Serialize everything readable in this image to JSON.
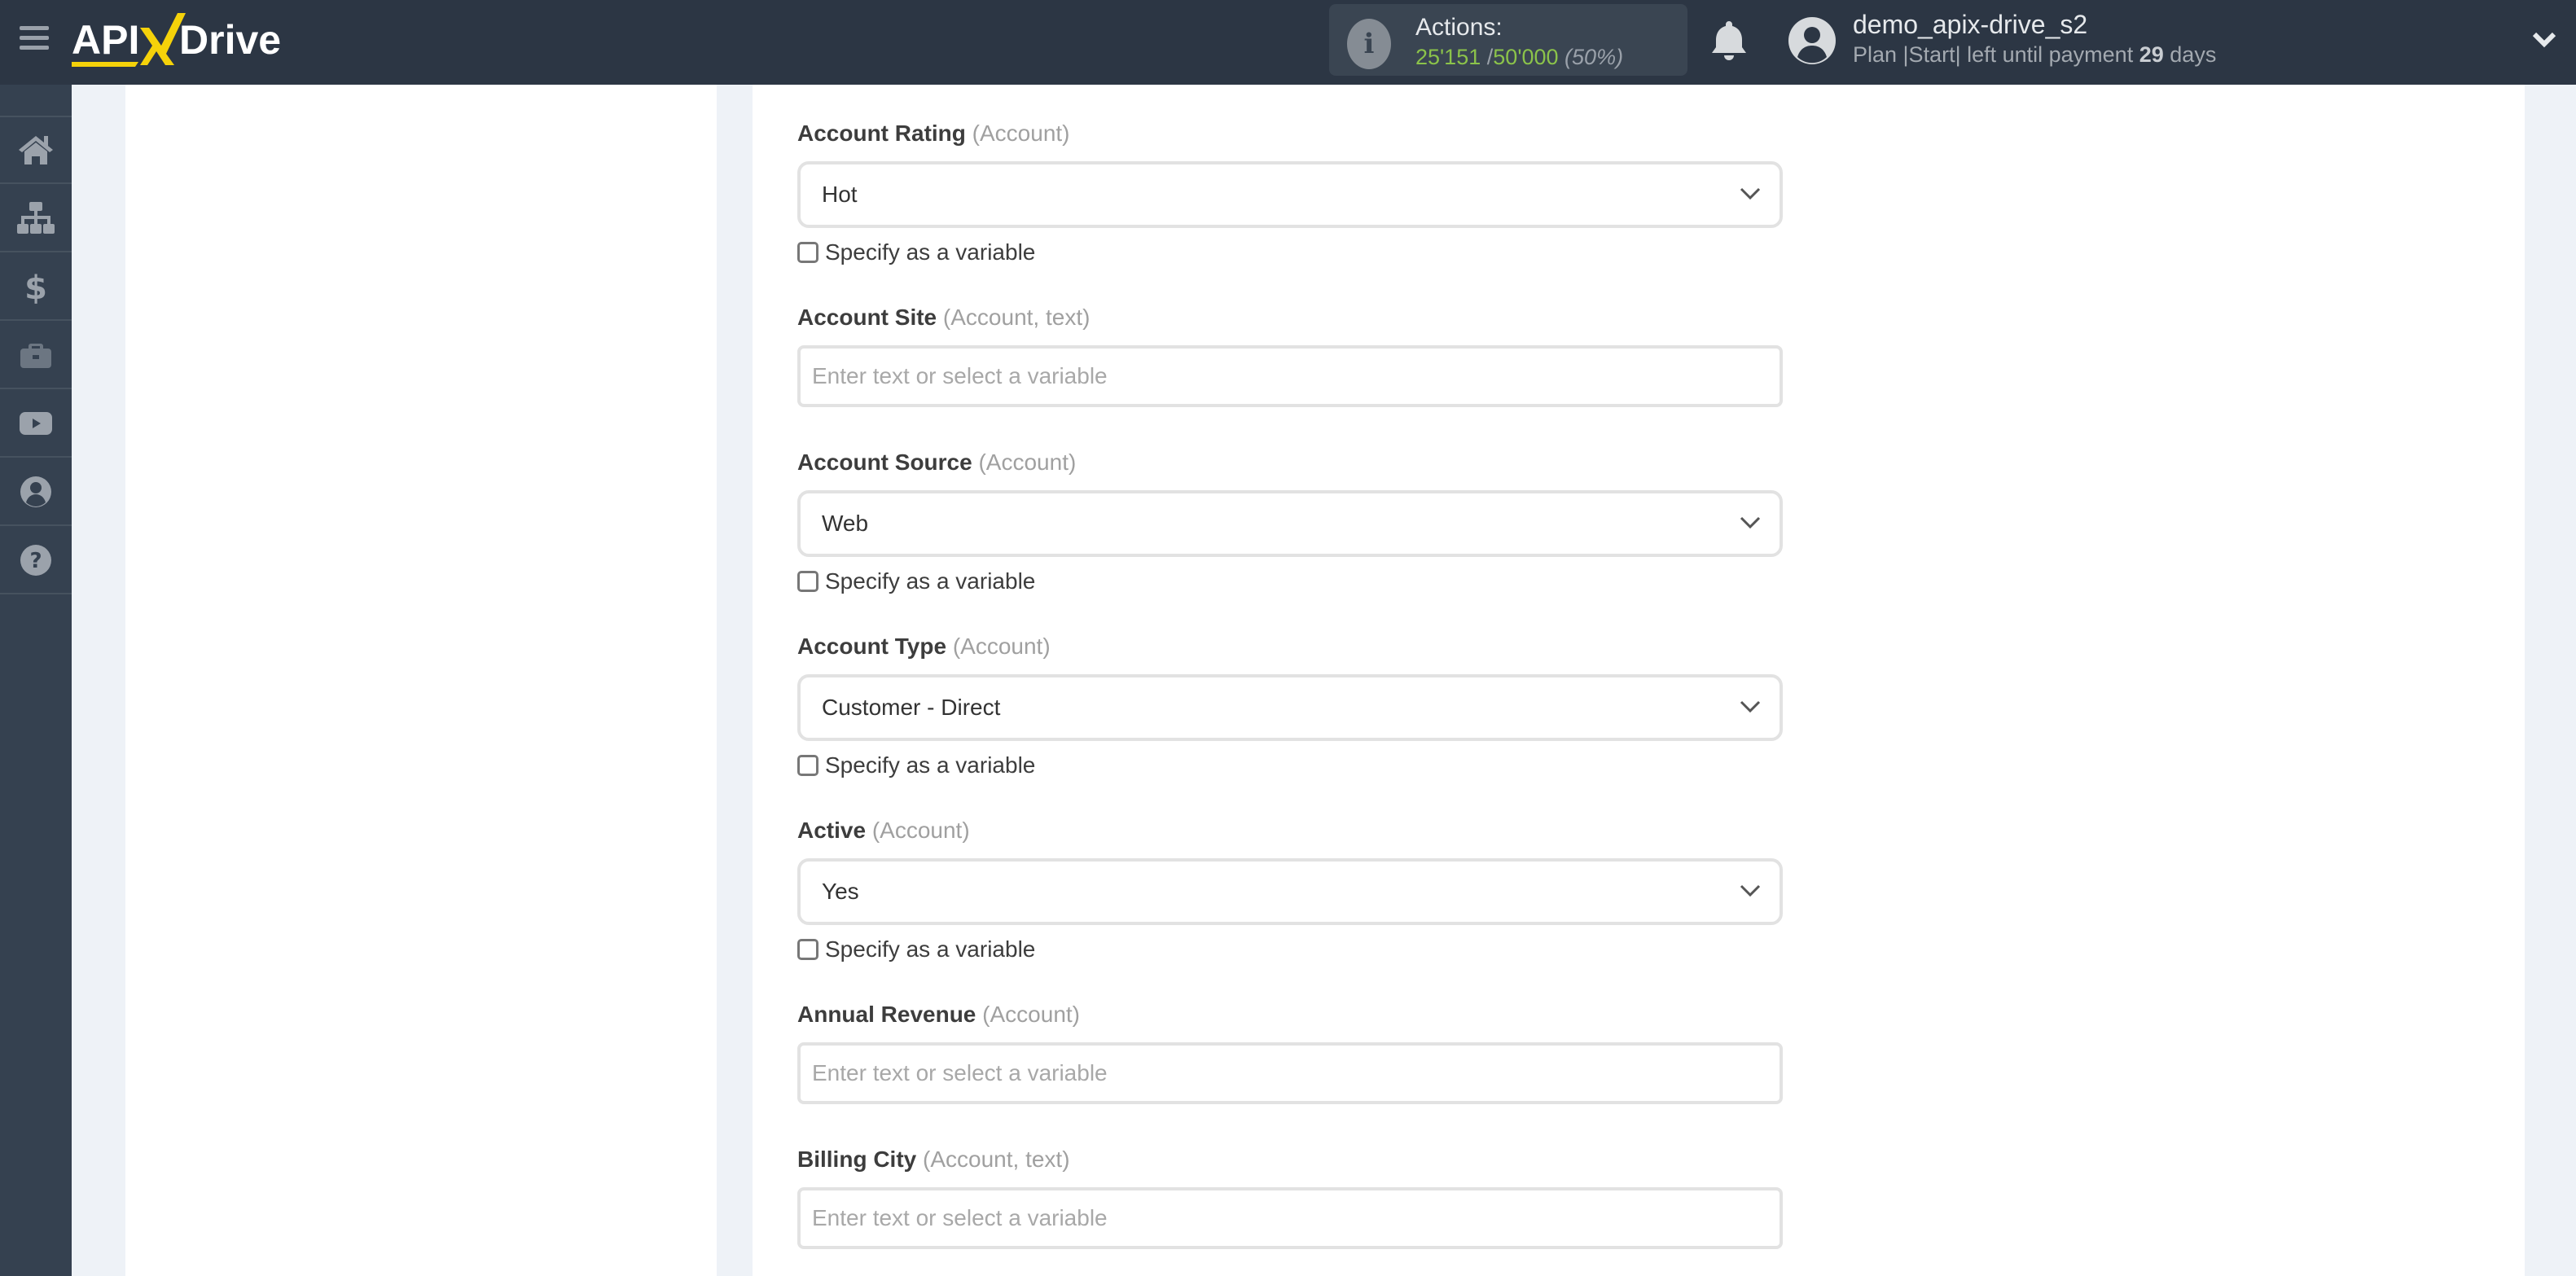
{
  "header": {
    "logo_text": "APIXDrive",
    "actions_label": "Actions:",
    "actions_used": "25'151",
    "actions_separator": "/",
    "actions_total": "50'000",
    "actions_percent": "(50%)",
    "username": "demo_apix-drive_s2",
    "plan_prefix": "Plan |Start| left until payment",
    "plan_days": "29",
    "plan_suffix": "days"
  },
  "sidebar": {
    "items": [
      {
        "icon": "home-icon",
        "label": "Home"
      },
      {
        "icon": "sitemap-icon",
        "label": "Connections"
      },
      {
        "icon": "dollar-icon",
        "label": "Billing"
      },
      {
        "icon": "briefcase-icon",
        "label": "Services"
      },
      {
        "icon": "youtube-icon",
        "label": "Video"
      },
      {
        "icon": "user-icon",
        "label": "Account"
      },
      {
        "icon": "help-icon",
        "label": "Help"
      }
    ]
  },
  "form": {
    "checkbox_label": "Specify as a variable",
    "fields": [
      {
        "label": "Account Rating",
        "hint": "(Account)",
        "type": "select",
        "value": "Hot",
        "checked": false
      },
      {
        "label": "Account Site",
        "hint": "(Account, text)",
        "type": "text",
        "placeholder": "Enter text or select a variable"
      },
      {
        "label": "Account Source",
        "hint": "(Account)",
        "type": "select",
        "value": "Web",
        "checked": false
      },
      {
        "label": "Account Type",
        "hint": "(Account)",
        "type": "select",
        "value": "Customer - Direct",
        "checked": false
      },
      {
        "label": "Active",
        "hint": "(Account)",
        "type": "select",
        "value": "Yes",
        "checked": false
      },
      {
        "label": "Annual Revenue",
        "hint": "(Account)",
        "type": "text",
        "placeholder": "Enter text or select a variable"
      },
      {
        "label": "Billing City",
        "hint": "(Account, text)",
        "type": "text",
        "placeholder": "Enter text or select a variable"
      }
    ]
  },
  "colors": {
    "header_bg": "#2c3644",
    "sidebar_bg": "#354150",
    "accent_yellow": "#f5d20a",
    "actions_green": "#8bc34a"
  }
}
